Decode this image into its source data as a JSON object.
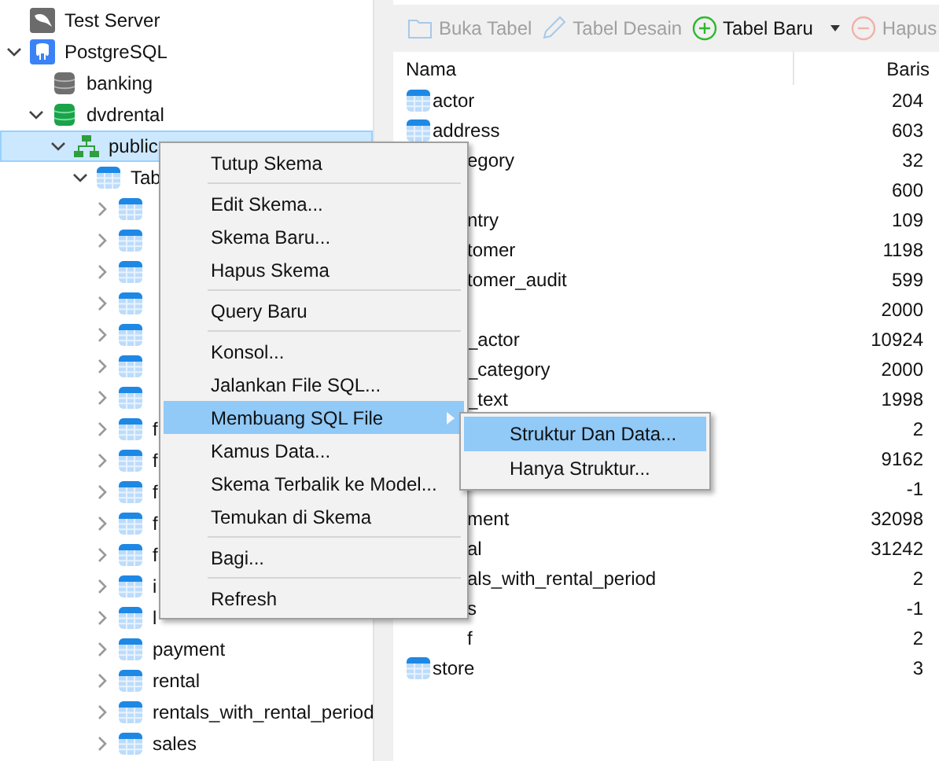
{
  "tree": [
    {
      "label": "Test Server",
      "kind": "server"
    },
    {
      "label": "PostgreSQL",
      "kind": "postgres",
      "expanded": true,
      "children": [
        {
          "label": "banking",
          "kind": "database",
          "open": false
        },
        {
          "label": "dvdrental",
          "kind": "database",
          "open": true,
          "expanded": true,
          "children": [
            {
              "label": "public",
              "kind": "schema",
              "expanded": true,
              "selected": true,
              "children": [
                {
                  "label": "Tab",
                  "kind": "tables",
                  "expanded": true,
                  "children": [
                    {
                      "kind": "table",
                      "expanded": false
                    },
                    {
                      "kind": "table",
                      "expanded": false
                    },
                    {
                      "kind": "table",
                      "expanded": false
                    },
                    {
                      "kind": "table",
                      "expanded": false
                    },
                    {
                      "kind": "table",
                      "expanded": false
                    },
                    {
                      "kind": "table",
                      "expanded": false
                    },
                    {
                      "kind": "table",
                      "expanded": false
                    },
                    {
                      "label": "f",
                      "kind": "table",
                      "expanded": false
                    },
                    {
                      "label": "f",
                      "kind": "table",
                      "expanded": false
                    },
                    {
                      "label": "f",
                      "kind": "table",
                      "expanded": false
                    },
                    {
                      "label": "f",
                      "kind": "table",
                      "expanded": false
                    },
                    {
                      "label": "f",
                      "kind": "table",
                      "expanded": false
                    },
                    {
                      "label": "i",
                      "kind": "table",
                      "expanded": false
                    },
                    {
                      "label": "l",
                      "kind": "table",
                      "expanded": false
                    },
                    {
                      "label": "payment",
                      "kind": "table",
                      "expanded": false
                    },
                    {
                      "label": "rental",
                      "kind": "table",
                      "expanded": false
                    },
                    {
                      "label": "rentals_with_rental_period",
                      "kind": "table",
                      "expanded": false
                    },
                    {
                      "label": "sales",
                      "kind": "table",
                      "expanded": false
                    }
                  ]
                }
              ]
            }
          ]
        }
      ]
    }
  ],
  "toolbar": [
    {
      "label": "Buka Tabel",
      "kind": "folder",
      "disabled": true
    },
    {
      "label": "Tabel Desain",
      "kind": "pencil",
      "disabled": true
    },
    {
      "label": "Tabel Baru",
      "kind": "add",
      "disabled": false,
      "dropdown": true
    },
    {
      "label": "Hapus",
      "kind": "remove",
      "disabled": true
    }
  ],
  "table": {
    "columns": [
      "Nama",
      "Baris"
    ],
    "rows": [
      {
        "name": "actor",
        "icon": true,
        "rows": "204"
      },
      {
        "name": "address",
        "icon": true,
        "rows": "603"
      },
      {
        "name": "egory",
        "icon": false,
        "rows": "32"
      },
      {
        "rows": "600"
      },
      {
        "name": "ntry",
        "icon": false,
        "rows": "109"
      },
      {
        "name": "tomer",
        "icon": false,
        "rows": "1198"
      },
      {
        "name": "tomer_audit",
        "icon": false,
        "rows": "599"
      },
      {
        "rows": "2000"
      },
      {
        "name": "_actor",
        "icon": false,
        "rows": "10924"
      },
      {
        "name": "_category",
        "icon": false,
        "rows": "2000"
      },
      {
        "name": "_text",
        "icon": false,
        "rows": "1998"
      },
      {
        "rows": "2"
      },
      {
        "rows": "9162"
      },
      {
        "rows": "-1"
      },
      {
        "name": "ment",
        "icon": false,
        "rows": "32098"
      },
      {
        "name": "al",
        "icon": false,
        "rows": "31242"
      },
      {
        "name": "als_with_rental_period",
        "icon": false,
        "rows": "2"
      },
      {
        "name": "s",
        "icon": false,
        "rows": "-1"
      },
      {
        "name": "f",
        "icon": false,
        "rows": "2"
      },
      {
        "name": "store",
        "icon": true,
        "rows": "3"
      }
    ]
  },
  "context_menu": {
    "items": [
      {
        "kind": "item",
        "label": "Tutup Skema",
        "selected": false
      },
      {
        "kind": "separator"
      },
      {
        "kind": "item",
        "label": "Edit Skema...",
        "selected": false
      },
      {
        "kind": "item",
        "label": "Skema Baru...",
        "selected": false
      },
      {
        "kind": "item",
        "label": "Hapus Skema",
        "selected": false
      },
      {
        "kind": "separator"
      },
      {
        "kind": "item",
        "label": "Query Baru",
        "selected": false
      },
      {
        "kind": "separator"
      },
      {
        "kind": "item",
        "label": "Konsol...",
        "selected": false
      },
      {
        "kind": "item",
        "label": "Jalankan File SQL...",
        "selected": false
      },
      {
        "kind": "submenu",
        "label": "Membuang SQL File",
        "selected": true
      },
      {
        "kind": "item",
        "label": "Kamus Data...",
        "selected": false
      },
      {
        "kind": "item",
        "label": "Skema Terbalik ke Model...",
        "selected": false
      },
      {
        "kind": "item",
        "label": "Temukan di Skema",
        "selected": false
      },
      {
        "kind": "separator"
      },
      {
        "kind": "item",
        "label": "Bagi...",
        "selected": false
      },
      {
        "kind": "separator"
      },
      {
        "kind": "item",
        "label": "Refresh",
        "selected": false
      }
    ]
  },
  "submenu": {
    "items": [
      {
        "label": "Struktur Dan Data...",
        "selected": true
      },
      {
        "label": "Hanya Struktur...",
        "selected": false
      }
    ]
  }
}
